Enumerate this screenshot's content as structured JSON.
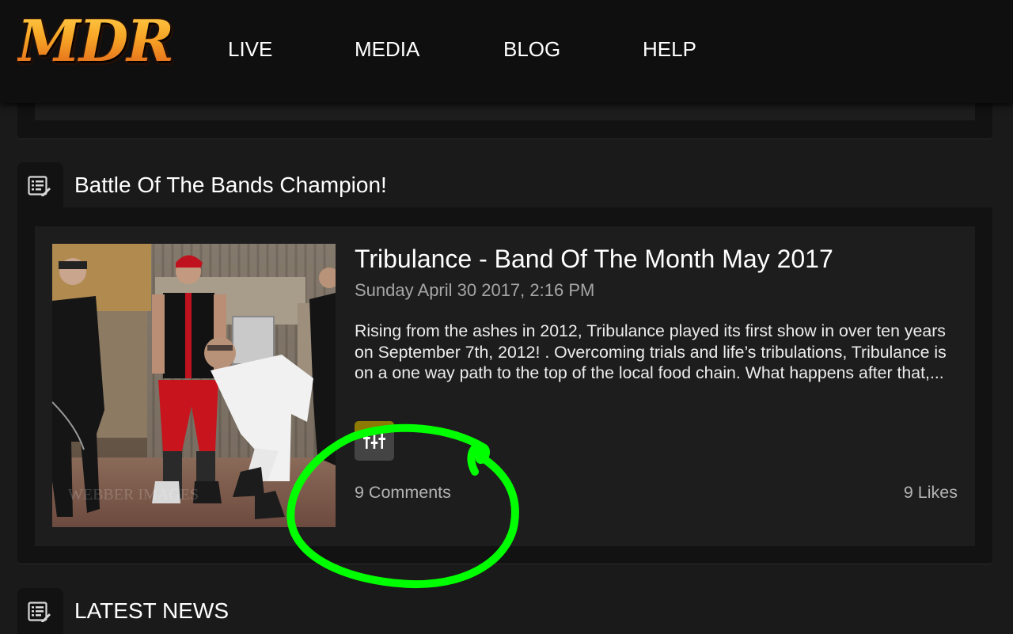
{
  "header": {
    "logo_text": "MDR",
    "nav": [
      "LIVE",
      "MEDIA",
      "BLOG",
      "HELP"
    ]
  },
  "featured": {
    "section_title": "Battle Of The Bands Champion!",
    "article": {
      "title": "Tribulance - Band Of The Month May 2017",
      "date": "Sunday April 30 2017, 2:16 PM",
      "excerpt": "Rising from the ashes in 2012, Tribulance played its first show in over ten years on September 7th, 2012! . Overcoming trials and life’s tribulations, Tribulance is on a one way path to the top of the local food chain. What happens after that,...",
      "comments": "9 Comments",
      "likes": "9 Likes",
      "photo_icon": "band-photo"
    }
  },
  "latest": {
    "section_title": "LATEST NEWS"
  },
  "icons": {
    "section_icon": "news-list-icon",
    "share_icon": "sliders-icon"
  },
  "colors": {
    "background": "#1a1a1a",
    "header": "#0f0f0f",
    "panel": "#121212",
    "card": "#1d1d1d",
    "logo_orange": "#f28a21",
    "muted_text": "#a6a6a6",
    "annotation_green": "#00ff00",
    "share_highlight": "#8d7a05"
  }
}
